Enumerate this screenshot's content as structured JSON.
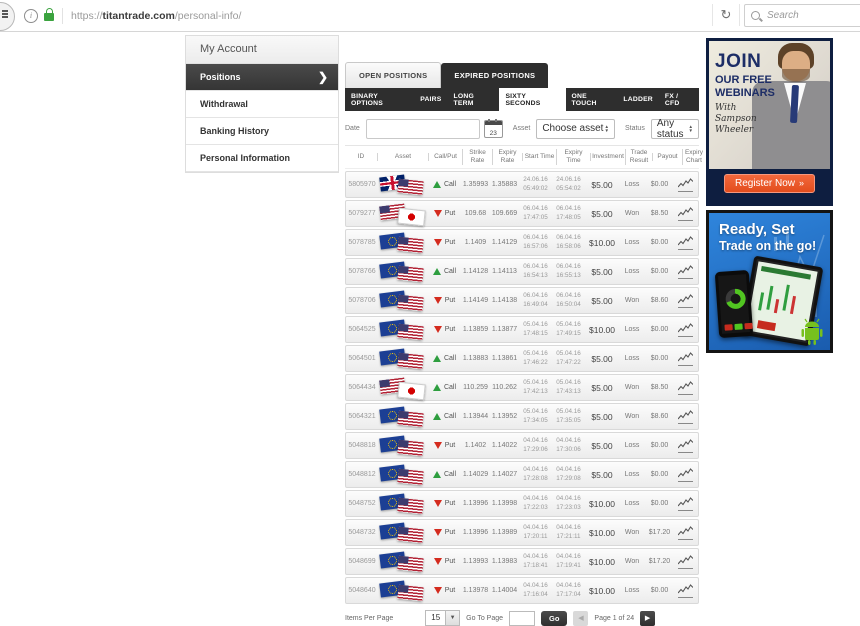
{
  "browser": {
    "url": {
      "scheme": "https://",
      "domain": "titantrade.com",
      "path": "/personal-info/"
    },
    "search_placeholder": "Search",
    "reload_glyph": "↻",
    "info_glyph": "i"
  },
  "sidebar": {
    "header": "My Account",
    "items": [
      {
        "label": "Positions",
        "active": true
      },
      {
        "label": "Withdrawal",
        "active": false
      },
      {
        "label": "Banking History",
        "active": false
      },
      {
        "label": "Personal Information",
        "active": false
      }
    ]
  },
  "tabs": {
    "open": "OPEN POSITIONS",
    "expired": "EXPIRED POSITIONS"
  },
  "subtabs": [
    "BINARY OPTIONS",
    "PAIRS",
    "LONG TERM",
    "SIXTY SECONDS",
    "ONE TOUCH",
    "LADDER",
    "FX / CFD"
  ],
  "active_subtab": "SIXTY SECONDS",
  "filters": {
    "date_label": "Date",
    "calendar_day": "23",
    "asset_label": "Asset",
    "asset_value": "Choose asset",
    "status_label": "Status",
    "status_value": "Any status"
  },
  "table": {
    "columns": [
      "ID",
      "Asset",
      "Call/Put",
      "Strike Rate",
      "Expiry Rate",
      "Start Time",
      "Expiry Time",
      "Investment",
      "Trade Result",
      "Payout",
      "Expiry Chart"
    ],
    "rows": [
      {
        "id": "5805970",
        "asset": "GBP/USD",
        "flags": [
          "uk",
          "us"
        ],
        "direction": "Call",
        "strike": "1.35993",
        "expiry_rate": "1.35883",
        "start_date": "24.06.16",
        "start_time": "05:49:02",
        "expiry_date": "24.06.16",
        "expiry_time": "05:54:02",
        "investment": "$5.00",
        "result": "Loss",
        "payout": "$0.00"
      },
      {
        "id": "5079277",
        "asset": "USD/JPY",
        "flags": [
          "us",
          "jp"
        ],
        "direction": "Put",
        "strike": "109.68",
        "expiry_rate": "109.669",
        "start_date": "06.04.16",
        "start_time": "17:47:05",
        "expiry_date": "06.04.16",
        "expiry_time": "17:48:05",
        "investment": "$5.00",
        "result": "Won",
        "payout": "$8.50"
      },
      {
        "id": "5078785",
        "asset": "EUR/USD",
        "flags": [
          "eu",
          "us"
        ],
        "direction": "Put",
        "strike": "1.1409",
        "expiry_rate": "1.14129",
        "start_date": "06.04.16",
        "start_time": "16:57:06",
        "expiry_date": "06.04.16",
        "expiry_time": "16:58:06",
        "investment": "$10.00",
        "result": "Loss",
        "payout": "$0.00"
      },
      {
        "id": "5078766",
        "asset": "EUR/USD",
        "flags": [
          "eu",
          "us"
        ],
        "direction": "Call",
        "strike": "1.14128",
        "expiry_rate": "1.14113",
        "start_date": "06.04.16",
        "start_time": "16:54:13",
        "expiry_date": "06.04.16",
        "expiry_time": "16:55:13",
        "investment": "$5.00",
        "result": "Loss",
        "payout": "$0.00"
      },
      {
        "id": "5078706",
        "asset": "EUR/USD",
        "flags": [
          "eu",
          "us"
        ],
        "direction": "Put",
        "strike": "1.14149",
        "expiry_rate": "1.14138",
        "start_date": "06.04.16",
        "start_time": "16:49:04",
        "expiry_date": "06.04.16",
        "expiry_time": "16:50:04",
        "investment": "$5.00",
        "result": "Won",
        "payout": "$8.60"
      },
      {
        "id": "5064525",
        "asset": "EUR/USD",
        "flags": [
          "eu",
          "us"
        ],
        "direction": "Put",
        "strike": "1.13859",
        "expiry_rate": "1.13877",
        "start_date": "05.04.16",
        "start_time": "17:48:15",
        "expiry_date": "05.04.16",
        "expiry_time": "17:49:15",
        "investment": "$10.00",
        "result": "Loss",
        "payout": "$0.00"
      },
      {
        "id": "5064501",
        "asset": "EUR/USD",
        "flags": [
          "eu",
          "us"
        ],
        "direction": "Call",
        "strike": "1.13883",
        "expiry_rate": "1.13861",
        "start_date": "05.04.16",
        "start_time": "17:46:22",
        "expiry_date": "05.04.16",
        "expiry_time": "17:47:22",
        "investment": "$5.00",
        "result": "Loss",
        "payout": "$0.00"
      },
      {
        "id": "5064434",
        "asset": "USD/JPY",
        "flags": [
          "us",
          "jp"
        ],
        "direction": "Call",
        "strike": "110.259",
        "expiry_rate": "110.262",
        "start_date": "05.04.16",
        "start_time": "17:42:13",
        "expiry_date": "05.04.16",
        "expiry_time": "17:43:13",
        "investment": "$5.00",
        "result": "Won",
        "payout": "$8.50"
      },
      {
        "id": "5064321",
        "asset": "EUR/USD",
        "flags": [
          "eu",
          "us"
        ],
        "direction": "Call",
        "strike": "1.13944",
        "expiry_rate": "1.13952",
        "start_date": "05.04.16",
        "start_time": "17:34:05",
        "expiry_date": "05.04.16",
        "expiry_time": "17:35:05",
        "investment": "$5.00",
        "result": "Won",
        "payout": "$8.60"
      },
      {
        "id": "5048818",
        "asset": "EUR/USD",
        "flags": [
          "eu",
          "us"
        ],
        "direction": "Put",
        "strike": "1.1402",
        "expiry_rate": "1.14022",
        "start_date": "04.04.16",
        "start_time": "17:29:06",
        "expiry_date": "04.04.16",
        "expiry_time": "17:30:06",
        "investment": "$5.00",
        "result": "Loss",
        "payout": "$0.00"
      },
      {
        "id": "5048812",
        "asset": "EUR/USD",
        "flags": [
          "eu",
          "us"
        ],
        "direction": "Call",
        "strike": "1.14029",
        "expiry_rate": "1.14027",
        "start_date": "04.04.16",
        "start_time": "17:28:08",
        "expiry_date": "04.04.16",
        "expiry_time": "17:29:08",
        "investment": "$5.00",
        "result": "Loss",
        "payout": "$0.00"
      },
      {
        "id": "5048752",
        "asset": "EUR/USD",
        "flags": [
          "eu",
          "us"
        ],
        "direction": "Put",
        "strike": "1.13996",
        "expiry_rate": "1.13998",
        "start_date": "04.04.16",
        "start_time": "17:22:03",
        "expiry_date": "04.04.16",
        "expiry_time": "17:23:03",
        "investment": "$10.00",
        "result": "Loss",
        "payout": "$0.00"
      },
      {
        "id": "5048732",
        "asset": "EUR/USD",
        "flags": [
          "eu",
          "us"
        ],
        "direction": "Put",
        "strike": "1.13996",
        "expiry_rate": "1.13989",
        "start_date": "04.04.16",
        "start_time": "17:20:11",
        "expiry_date": "04.04.16",
        "expiry_time": "17:21:11",
        "investment": "$10.00",
        "result": "Won",
        "payout": "$17.20"
      },
      {
        "id": "5048699",
        "asset": "EUR/USD",
        "flags": [
          "eu",
          "us"
        ],
        "direction": "Put",
        "strike": "1.13993",
        "expiry_rate": "1.13983",
        "start_date": "04.04.16",
        "start_time": "17:18:41",
        "expiry_date": "04.04.16",
        "expiry_time": "17:19:41",
        "investment": "$10.00",
        "result": "Won",
        "payout": "$17.20"
      },
      {
        "id": "5048640",
        "asset": "EUR/USD",
        "flags": [
          "eu",
          "us"
        ],
        "direction": "Put",
        "strike": "1.13978",
        "expiry_rate": "1.14004",
        "start_date": "04.04.16",
        "start_time": "17:16:04",
        "expiry_date": "04.04.16",
        "expiry_time": "17:17:04",
        "investment": "$10.00",
        "result": "Loss",
        "payout": "$0.00"
      }
    ]
  },
  "pagination": {
    "items_per_page_label": "Items Per Page",
    "items_per_page_value": "15",
    "go_to_page_label": "Go To Page",
    "go_button": "Go",
    "prev_glyph": "◀",
    "next_glyph": "▶",
    "page_status": "Page 1 of 24"
  },
  "ads": {
    "webinar": {
      "line1": "JOIN",
      "line2": "OUR FREE",
      "line3": "WEBINARS",
      "line4": "With Sampson Wheeler",
      "cta": "Register Now",
      "cta_arrow": "»"
    },
    "mobile": {
      "line1": "Ready, Set",
      "line2": "Trade on the go!"
    }
  },
  "colors": {
    "accent_orange": "#ee5a26",
    "dark_bar": "#2e2e2e",
    "navy": "#0e1e40",
    "ad_blue": "#2277cc",
    "call_green": "#2e9e3f",
    "put_red": "#d42b1e",
    "lock_green": "#3ba33f"
  }
}
